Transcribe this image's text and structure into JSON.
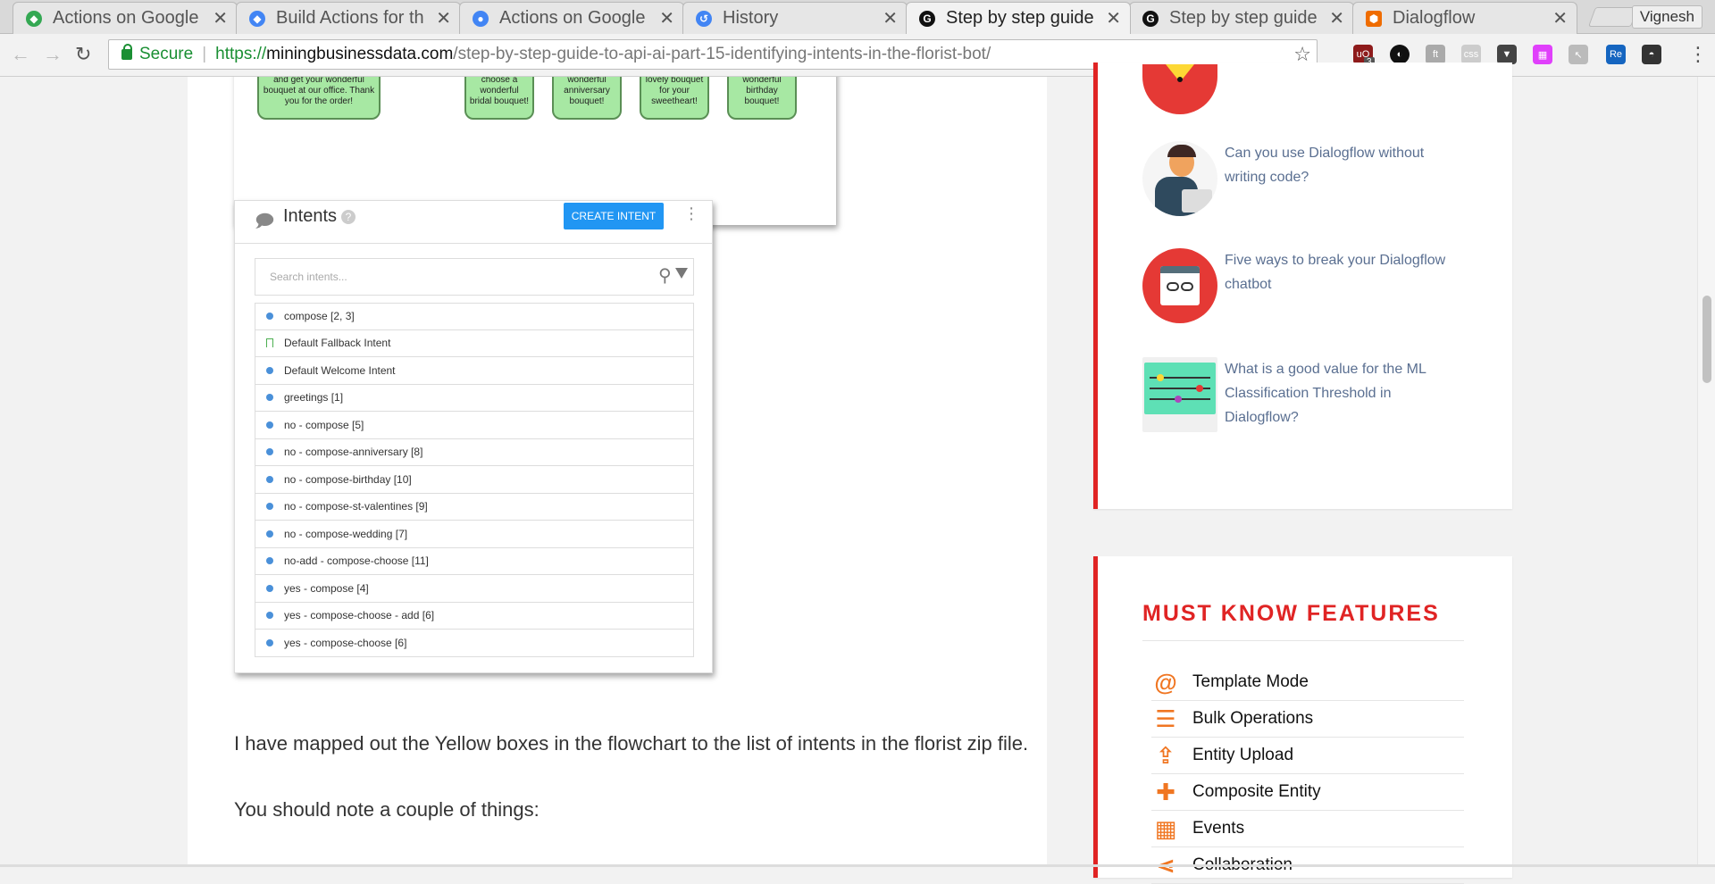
{
  "browser": {
    "tabs": [
      {
        "title": "Actions on Google",
        "favicon": "google-actions-icon",
        "color": "#34a853"
      },
      {
        "title": "Build Actions for th",
        "favicon": "google-actions-icon",
        "color": "#4285f4"
      },
      {
        "title": "Actions on Google",
        "favicon": "google-assistant-icon",
        "color": "#4285f4"
      },
      {
        "title": "History",
        "favicon": "history-icon",
        "color": "#4285f4"
      },
      {
        "title": "Step by step guide",
        "favicon": "github-icon",
        "color": "#111111",
        "active": true
      },
      {
        "title": "Step by step guide",
        "favicon": "github-icon",
        "color": "#111111"
      },
      {
        "title": "Dialogflow",
        "favicon": "dialogflow-icon",
        "color": "#ef6c00"
      }
    ],
    "profile_name": "Vignesh",
    "secure_label": "Secure",
    "url_proto": "https://",
    "url_host": "miningbusinessdata.com",
    "url_path": "/step-by-step-guide-to-api-ai-part-15-identifying-intents-in-the-florist-bot/",
    "extension_badge": "3"
  },
  "flowchart": {
    "boxes": [
      "Super! You can purchase and get your wonderful bouquet at our office. Thank you for the order!",
      "Here you can choose a wonderful bridal bouquet!",
      "Here you can choose a wonderful anniversary bouquet!",
      "Here you can choose a lovely bouquet for your sweetheart!",
      "Here you can choose a wonderful birthday bouquet!"
    ]
  },
  "intents": {
    "title": "Intents",
    "help": "?",
    "create_label": "CREATE INTENT",
    "search_placeholder": "Search intents...",
    "items": [
      {
        "label": "compose [2, 3]",
        "type": "dot"
      },
      {
        "label": "Default Fallback Intent",
        "type": "bookmark"
      },
      {
        "label": "Default Welcome Intent",
        "type": "dot"
      },
      {
        "label": "greetings [1]",
        "type": "dot"
      },
      {
        "label": "no - compose [5]",
        "type": "dot"
      },
      {
        "label": "no - compose-anniversary [8]",
        "type": "dot"
      },
      {
        "label": "no - compose-birthday [10]",
        "type": "dot"
      },
      {
        "label": "no - compose-st-valentines [9]",
        "type": "dot"
      },
      {
        "label": "no - compose-wedding [7]",
        "type": "dot"
      },
      {
        "label": "no-add - compose-choose [11]",
        "type": "dot"
      },
      {
        "label": "yes - compose [4]",
        "type": "dot"
      },
      {
        "label": "yes - compose-choose - add [6]",
        "type": "dot"
      },
      {
        "label": "yes - compose-choose [6]",
        "type": "dot"
      }
    ]
  },
  "article": {
    "para1": "I have mapped out the Yellow boxes in the flowchart to the list of intents in the florist zip file.",
    "para2": "You should note a couple of things:"
  },
  "sidebar": {
    "posts": [
      {
        "title": "Can you use Dialogflow without writing code?",
        "thumb": "person-laptop-icon"
      },
      {
        "title": "Five ways to break your Dialogflow chatbot",
        "thumb": "broken-chain-icon"
      },
      {
        "title": "What is a good value for the ML Classification Threshold in Dialogflow?",
        "thumb": "slider-settings-icon"
      }
    ],
    "features_title": "MUST KNOW FEATURES",
    "features": [
      {
        "label": "Template Mode",
        "icon": "at-sign-icon"
      },
      {
        "label": "Bulk Operations",
        "icon": "list-icon"
      },
      {
        "label": "Entity Upload",
        "icon": "upload-icon"
      },
      {
        "label": "Composite Entity",
        "icon": "plus-icon"
      },
      {
        "label": "Events",
        "icon": "calendar-icon"
      },
      {
        "label": "Collaboration",
        "icon": "share-icon"
      }
    ],
    "accent": "#e02424",
    "feature_icon_color": "#f07622"
  }
}
